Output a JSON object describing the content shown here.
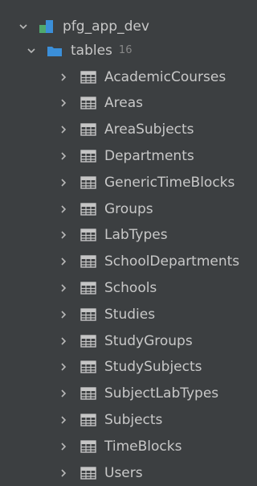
{
  "database": {
    "name": "pfg_app_dev",
    "expanded": true
  },
  "folder": {
    "name": "tables",
    "count": "16",
    "expanded": true
  },
  "tables": [
    "AcademicCourses",
    "Areas",
    "AreaSubjects",
    "Departments",
    "GenericTimeBlocks",
    "Groups",
    "LabTypes",
    "SchoolDepartments",
    "Schools",
    "Studies",
    "StudyGroups",
    "StudySubjects",
    "SubjectLabTypes",
    "Subjects",
    "TimeBlocks",
    "Users"
  ],
  "colors": {
    "background": "#3c3f41",
    "text": "#c8c8c8",
    "count": "#888888",
    "icon_blue": "#3b8fd9",
    "db_green": "#4fa86e",
    "table_icon": "#c5c5c5"
  },
  "icons": {
    "expanded": "chevron-down-icon",
    "collapsed": "chevron-right-icon",
    "database": "database-icon",
    "folder": "folder-icon",
    "table": "table-icon"
  }
}
